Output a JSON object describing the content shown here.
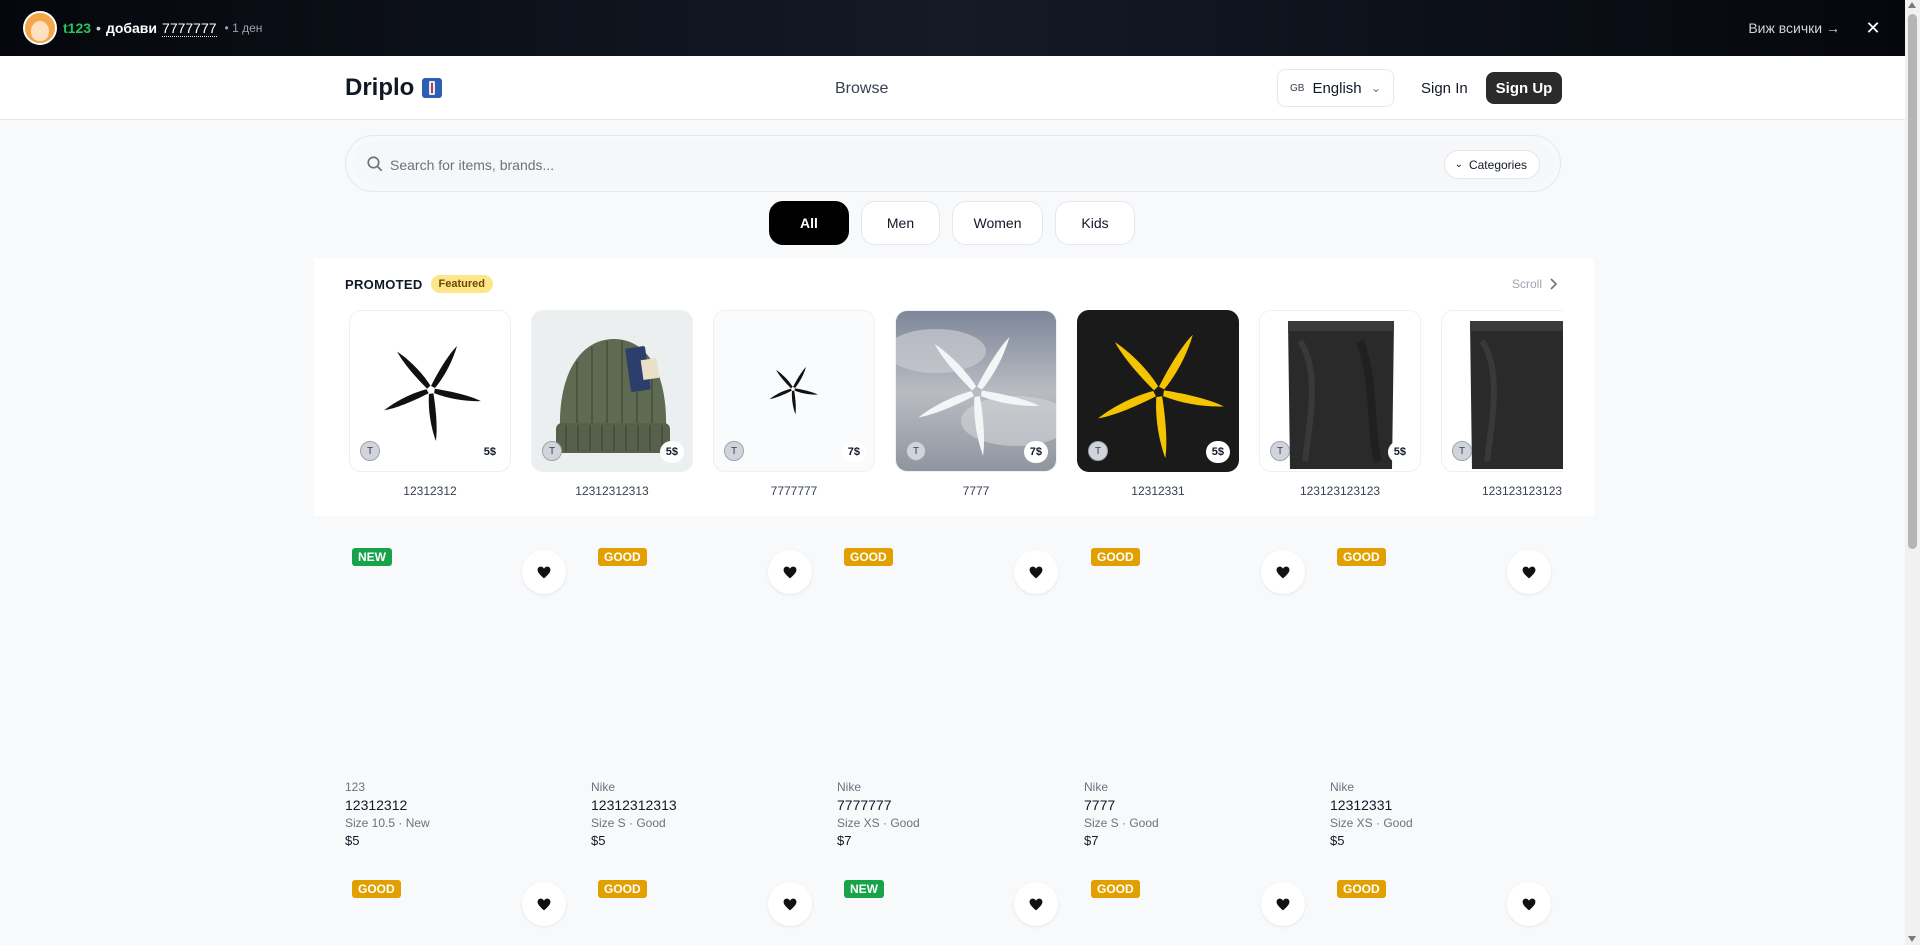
{
  "notification": {
    "user": "t123",
    "action": "добави",
    "target": "7777777",
    "time": "• 1 ден",
    "view_all": "Виж всички →",
    "close": "✕"
  },
  "header": {
    "logo": "Driplo",
    "browse": "Browse",
    "language_code": "GB",
    "language": "English",
    "sign_in": "Sign In",
    "sign_up": "Sign Up"
  },
  "search": {
    "placeholder": "Search for items, brands...",
    "categories_label": "Categories"
  },
  "tabs": [
    {
      "label": "All",
      "active": true
    },
    {
      "label": "Men",
      "active": false
    },
    {
      "label": "Women",
      "active": false
    },
    {
      "label": "Kids",
      "active": false
    }
  ],
  "promoted": {
    "title": "PROMOTED",
    "badge": "Featured",
    "scroll_label": "Scroll",
    "items": [
      {
        "name": "12312312",
        "price": "5$",
        "initial": "T"
      },
      {
        "name": "12312312313",
        "price": "5$",
        "initial": "T"
      },
      {
        "name": "7777777",
        "price": "7$",
        "initial": "T"
      },
      {
        "name": "7777",
        "price": "7$",
        "initial": "T"
      },
      {
        "name": "12312331",
        "price": "5$",
        "initial": "T"
      },
      {
        "name": "123123123123",
        "price": "5$",
        "initial": "T"
      },
      {
        "name": "123123123123",
        "price": "",
        "initial": "T"
      }
    ]
  },
  "products": [
    {
      "condition": "NEW",
      "brand": "123",
      "title": "12312312",
      "details": "Size 10.5 · New",
      "price": "$5"
    },
    {
      "condition": "GOOD",
      "brand": "Nike",
      "title": "12312312313",
      "details": "Size S · Good",
      "price": "$5"
    },
    {
      "condition": "GOOD",
      "brand": "Nike",
      "title": "7777777",
      "details": "Size XS · Good",
      "price": "$7"
    },
    {
      "condition": "GOOD",
      "brand": "Nike",
      "title": "7777",
      "details": "Size S · Good",
      "price": "$7"
    },
    {
      "condition": "GOOD",
      "brand": "Nike",
      "title": "12312331",
      "details": "Size XS · Good",
      "price": "$5"
    },
    {
      "condition": "GOOD"
    },
    {
      "condition": "GOOD"
    },
    {
      "condition": "NEW"
    },
    {
      "condition": "GOOD"
    },
    {
      "condition": "GOOD"
    }
  ],
  "colors": {
    "accent_dark": "#000000",
    "new_badge": "#16a34a",
    "good_badge": "#e2a000",
    "username": "#22c55e",
    "featured_badge": "#fde68a"
  }
}
